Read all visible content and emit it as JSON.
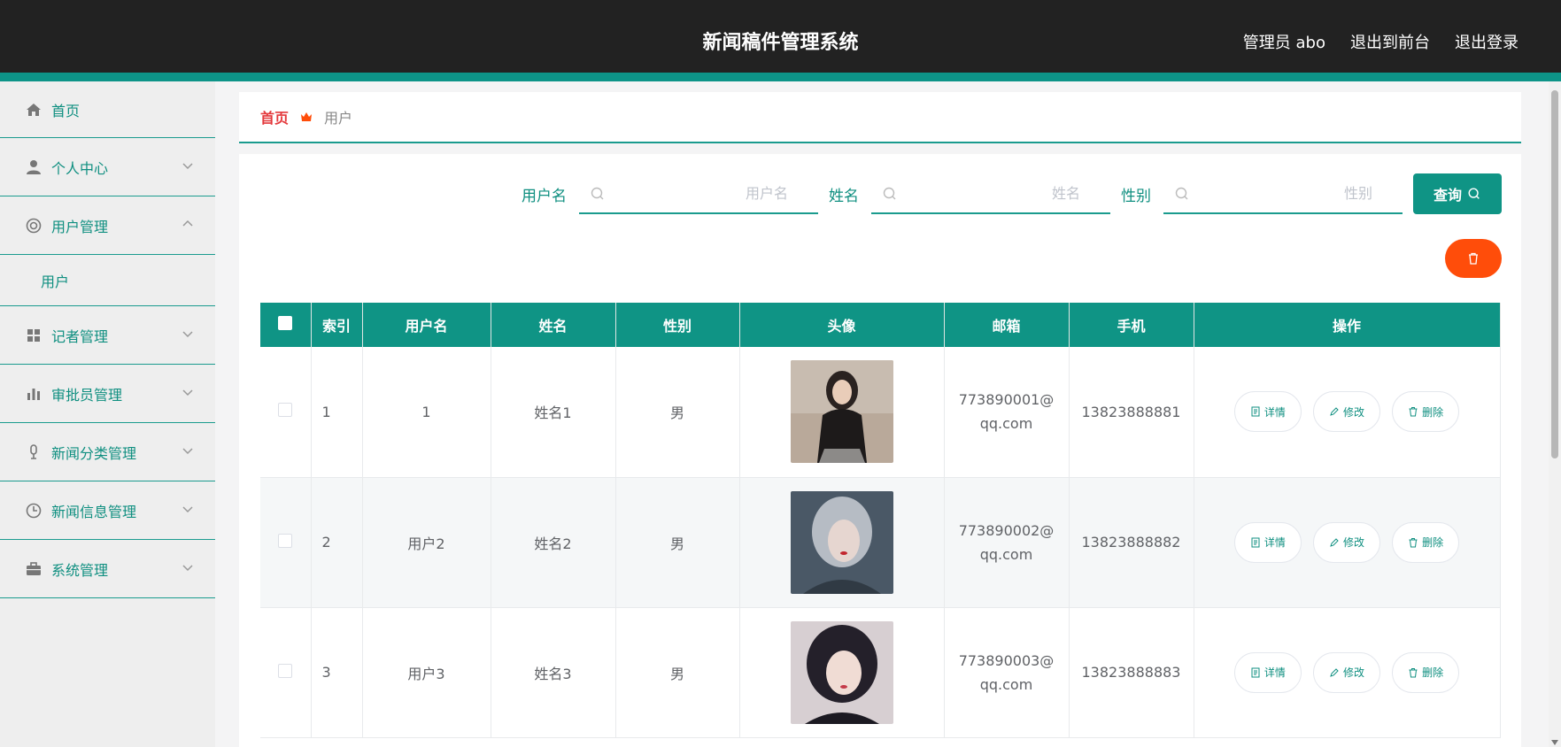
{
  "header": {
    "title": "新闻稿件管理系统",
    "admin_label": "管理员 abo",
    "back_front": "退出到前台",
    "logout": "退出登录"
  },
  "sidebar": {
    "items": [
      {
        "label": "首页",
        "icon": "home-icon"
      },
      {
        "label": "个人中心",
        "icon": "user-icon"
      },
      {
        "label": "用户管理",
        "icon": "lifebuoy-icon",
        "expanded": true,
        "children": [
          {
            "label": "用户"
          }
        ]
      },
      {
        "label": "记者管理",
        "icon": "grid-icon"
      },
      {
        "label": "审批员管理",
        "icon": "bar-chart-icon"
      },
      {
        "label": "新闻分类管理",
        "icon": "microphone-icon"
      },
      {
        "label": "新闻信息管理",
        "icon": "clock-icon"
      },
      {
        "label": "系统管理",
        "icon": "briefcase-icon"
      }
    ]
  },
  "breadcrumb": {
    "home": "首页",
    "current": "用户"
  },
  "search": {
    "username_label": "用户名",
    "username_placeholder": "用户名",
    "name_label": "姓名",
    "name_placeholder": "姓名",
    "gender_label": "性别",
    "gender_placeholder": "性别",
    "query_button": "查询"
  },
  "table": {
    "columns": [
      "索引",
      "用户名",
      "姓名",
      "性别",
      "头像",
      "邮箱",
      "手机",
      "操作"
    ],
    "rows": [
      {
        "index": "1",
        "username": "1",
        "name": "姓名1",
        "gender": "男",
        "email": "773890001@qq.com",
        "phone": "13823888881"
      },
      {
        "index": "2",
        "username": "用户2",
        "name": "姓名2",
        "gender": "男",
        "email": "773890002@qq.com",
        "phone": "13823888882"
      },
      {
        "index": "3",
        "username": "用户3",
        "name": "姓名3",
        "gender": "男",
        "email": "773890003@qq.com",
        "phone": "13823888883"
      }
    ],
    "actions": {
      "detail": "详情",
      "edit": "修改",
      "delete": "删除"
    }
  },
  "colors": {
    "accent": "#0f9485",
    "topbar": "#222222",
    "danger": "#ff4d0a",
    "breadcrumb_home": "#e4393c"
  }
}
